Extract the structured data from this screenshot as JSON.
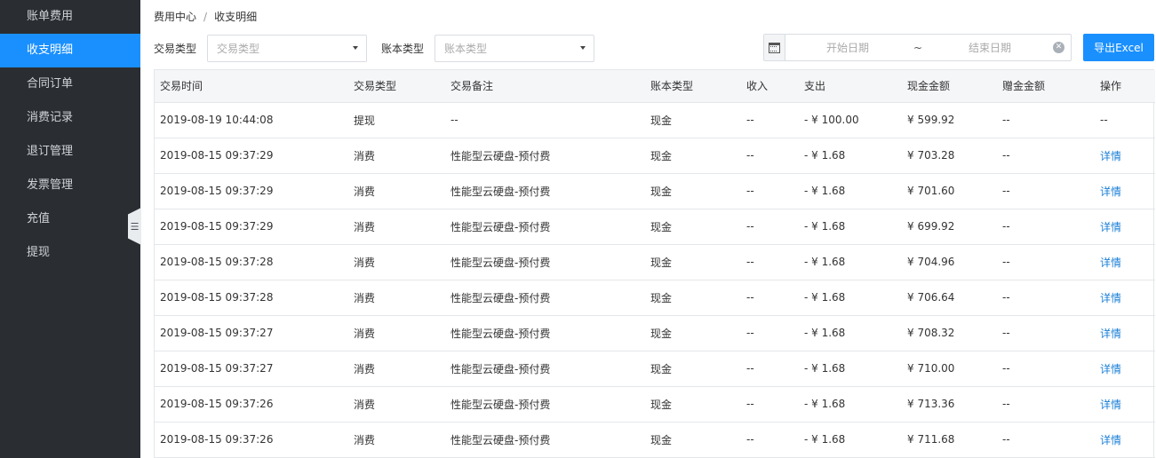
{
  "sidebar": {
    "items": [
      {
        "label": "账单费用",
        "active": false
      },
      {
        "label": "收支明细",
        "active": true
      },
      {
        "label": "合同订单",
        "active": false
      },
      {
        "label": "消费记录",
        "active": false
      },
      {
        "label": "退订管理",
        "active": false
      },
      {
        "label": "发票管理",
        "active": false
      },
      {
        "label": "充值",
        "active": false
      },
      {
        "label": "提现",
        "active": false
      }
    ]
  },
  "breadcrumb": {
    "parent": "费用中心",
    "separator": "/",
    "current": "收支明细"
  },
  "filters": {
    "trade_type_label": "交易类型",
    "trade_type_placeholder": "交易类型",
    "account_type_label": "账本类型",
    "account_type_placeholder": "账本类型",
    "start_date_placeholder": "开始日期",
    "range_separator": "~",
    "end_date_placeholder": "结束日期"
  },
  "export_label": "导出Excel",
  "table": {
    "columns": [
      "交易时间",
      "交易类型",
      "交易备注",
      "账本类型",
      "收入",
      "支出",
      "现金金额",
      "赠金金额",
      "操作"
    ],
    "rows": [
      [
        "2019-08-19 10:44:08",
        "提现",
        "--",
        "现金",
        "--",
        "- ¥ 100.00",
        "¥ 599.92",
        "--",
        "--"
      ],
      [
        "2019-08-15 09:37:29",
        "消费",
        "性能型云硬盘-预付费",
        "现金",
        "--",
        "- ¥ 1.68",
        "¥ 703.28",
        "--",
        "详情"
      ],
      [
        "2019-08-15 09:37:29",
        "消费",
        "性能型云硬盘-预付费",
        "现金",
        "--",
        "- ¥ 1.68",
        "¥ 701.60",
        "--",
        "详情"
      ],
      [
        "2019-08-15 09:37:29",
        "消费",
        "性能型云硬盘-预付费",
        "现金",
        "--",
        "- ¥ 1.68",
        "¥ 699.92",
        "--",
        "详情"
      ],
      [
        "2019-08-15 09:37:28",
        "消费",
        "性能型云硬盘-预付费",
        "现金",
        "--",
        "- ¥ 1.68",
        "¥ 704.96",
        "--",
        "详情"
      ],
      [
        "2019-08-15 09:37:28",
        "消费",
        "性能型云硬盘-预付费",
        "现金",
        "--",
        "- ¥ 1.68",
        "¥ 706.64",
        "--",
        "详情"
      ],
      [
        "2019-08-15 09:37:27",
        "消费",
        "性能型云硬盘-预付费",
        "现金",
        "--",
        "- ¥ 1.68",
        "¥ 708.32",
        "--",
        "详情"
      ],
      [
        "2019-08-15 09:37:27",
        "消费",
        "性能型云硬盘-预付费",
        "现金",
        "--",
        "- ¥ 1.68",
        "¥ 710.00",
        "--",
        "详情"
      ],
      [
        "2019-08-15 09:37:26",
        "消费",
        "性能型云硬盘-预付费",
        "现金",
        "--",
        "- ¥ 1.68",
        "¥ 713.36",
        "--",
        "详情"
      ],
      [
        "2019-08-15 09:37:26",
        "消费",
        "性能型云硬盘-预付费",
        "现金",
        "--",
        "- ¥ 1.68",
        "¥ 711.68",
        "--",
        "详情"
      ]
    ]
  },
  "colors": {
    "sidebar_bg": "#2a2e33",
    "accent": "#1a90ff",
    "link": "#1a7fd6"
  },
  "icons": {
    "calendar": "calendar-icon",
    "clear": "clear-icon",
    "collapse": "collapse-sidebar-icon",
    "dropdown": "chevron-down-icon"
  }
}
